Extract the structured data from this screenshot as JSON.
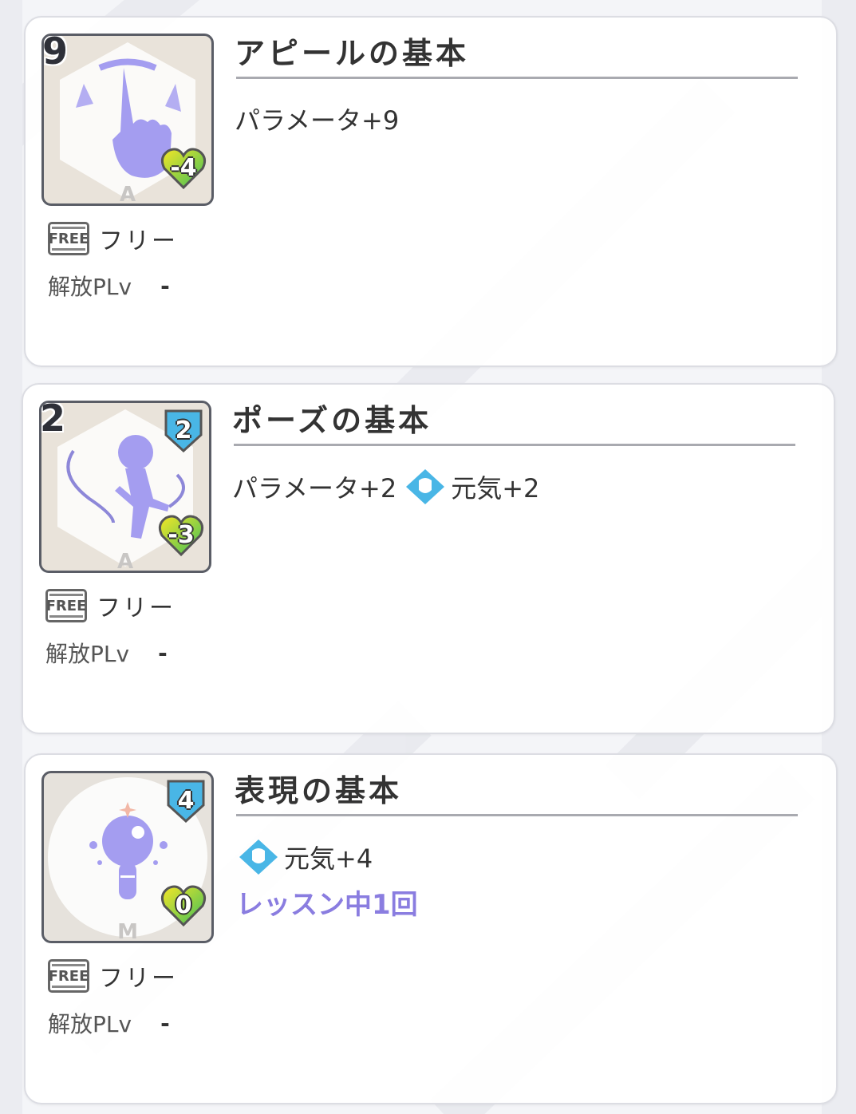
{
  "colors": {
    "background": "#f4f5f8",
    "card_border": "#dcdde3",
    "sub_effect": "#8a7de0",
    "shield_badge": "#49b6e6",
    "heart_badge_start": "#f5e626",
    "heart_badge_end": "#3fbf5a",
    "card_art": "#a49df0"
  },
  "common": {
    "free_tag": "FREE",
    "free_label": "フリー",
    "unlock_label": "解放PLv",
    "unlock_value": "-"
  },
  "cards": [
    {
      "cost": "9",
      "shield": null,
      "heart": "-4",
      "rarity": "A",
      "art": "hand-icon",
      "title": "アピールの基本",
      "effect": "パラメータ+9",
      "vital": null,
      "sub": null
    },
    {
      "cost": "2",
      "shield": "2",
      "heart": "-3",
      "rarity": "A",
      "art": "jump-rope-figure-icon",
      "title": "ポーズの基本",
      "effect": "パラメータ+2",
      "vital": "元気+2",
      "sub": null
    },
    {
      "cost": null,
      "shield": "4",
      "heart": "0",
      "rarity": "M",
      "art": "lightbulb-icon",
      "title": "表現の基本",
      "effect": "",
      "vital": "元気+4",
      "sub": "レッスン中1回"
    }
  ]
}
